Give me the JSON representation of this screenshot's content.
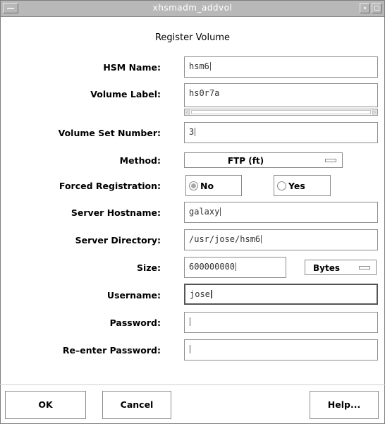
{
  "window": {
    "title": "xhsmadm_addvol"
  },
  "dialog": {
    "title": "Register Volume"
  },
  "fields": {
    "hsm_name": {
      "label": "HSM Name:",
      "value": "hsm6"
    },
    "volume_label": {
      "label": "Volume Label:",
      "value": "hs0r7a"
    },
    "volume_set_number": {
      "label": "Volume Set Number:",
      "value": "3"
    },
    "method": {
      "label": "Method:",
      "value": "FTP (ft)"
    },
    "forced_registration": {
      "label": "Forced Registration:",
      "options": [
        "No",
        "Yes"
      ],
      "selected": "No"
    },
    "server_hostname": {
      "label": "Server Hostname:",
      "value": "galaxy"
    },
    "server_directory": {
      "label": "Server Directory:",
      "value": "/usr/jose/hsm6"
    },
    "size": {
      "label": "Size:",
      "value": "600000000",
      "unit": "Bytes"
    },
    "username": {
      "label": "Username:",
      "value": "jose"
    },
    "password": {
      "label": "Password:",
      "value": ""
    },
    "reenter_password": {
      "label": "Re–enter Password:",
      "value": ""
    }
  },
  "buttons": {
    "ok": "OK",
    "cancel": "Cancel",
    "help": "Help..."
  }
}
